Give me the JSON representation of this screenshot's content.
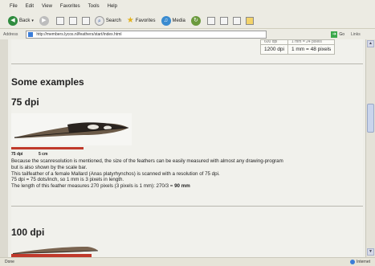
{
  "menu": [
    "File",
    "Edit",
    "View",
    "Favorites",
    "Tools",
    "Help"
  ],
  "toolbar": {
    "back": "Back",
    "search": "Search",
    "favorites": "Favorites",
    "media": "Media"
  },
  "address": {
    "label": "Address",
    "url": "http://members.lycos.nl/feathers/start/index.html",
    "go": "Go",
    "links": "Links"
  },
  "dpi_table": {
    "cut_left": "600 dpi",
    "cut_right": "1 mm = 24 pixels",
    "rows": [
      [
        "1200 dpi",
        "1 mm = 48 pixels"
      ]
    ]
  },
  "content": {
    "section_heading": "Some examples",
    "example1_heading": "75 dpi",
    "scale_label_1": "75 dpi",
    "scale_label_2": "5 cm",
    "para_line1": "Because the scanresolution is mentioned, the size of the feathers can be easily measured with almost any drawing-program",
    "para_line2": "but is also shown by the scale bar.",
    "para_line3": "This tailfeather of a female Mallard (Anas platyrhynchos) is scanned with a resolution of 75 dpi.",
    "para_line4": "75 dpi = 75 dots/inch, so 1 mm is 3 pixels in length.",
    "para_line5a": "The length of this feather measures 270 pixels (3 pixels is 1 mm): 270/3 =",
    "para_line5b": "90 mm",
    "example2_heading": "100 dpi"
  },
  "status": {
    "left": "Done",
    "zone": "Internet"
  }
}
